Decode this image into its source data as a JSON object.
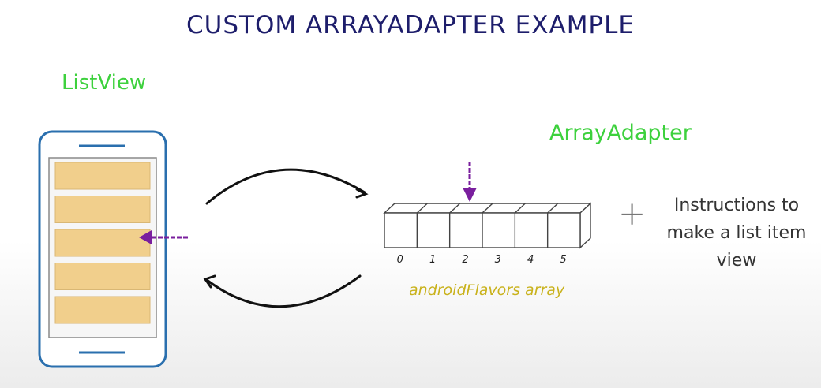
{
  "title": "CUSTOM ARRAYADAPTER EXAMPLE",
  "listview_label": "ListView",
  "adapter_label": "ArrayAdapter",
  "array": {
    "indices": [
      "0",
      "1",
      "2",
      "3",
      "4",
      "5"
    ],
    "label": "androidFlavors array"
  },
  "plus_sign": "+",
  "instructions": "Instructions to make a list item view",
  "colors": {
    "title": "#1d1d6b",
    "label_green": "#3dd13d",
    "array_label": "#c9b21c",
    "phone_border": "#2a6fae",
    "list_item": "#f1cf8c",
    "pointer_arrow": "#7a1f9e"
  },
  "list_items_count": 5
}
